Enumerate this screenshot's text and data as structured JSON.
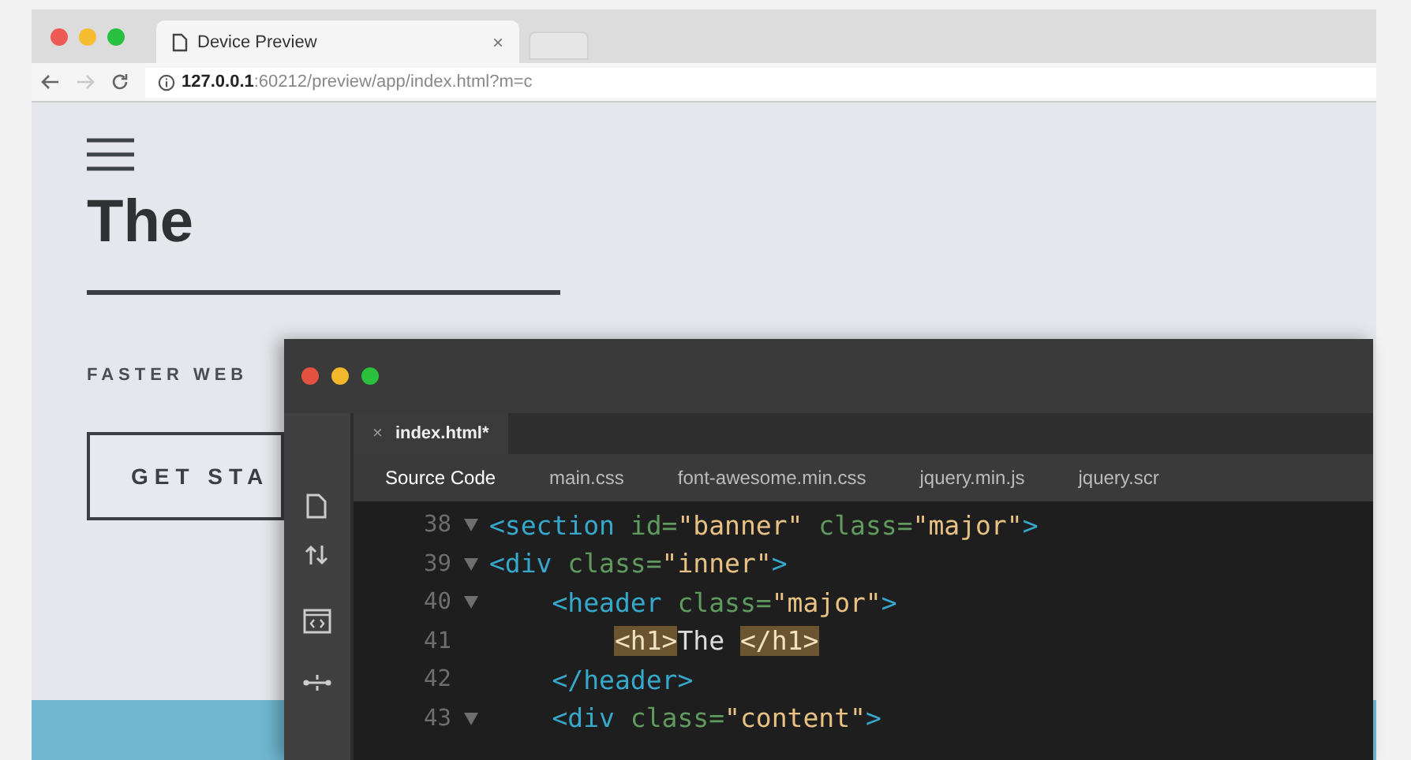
{
  "browser": {
    "tab": {
      "title": "Device Preview",
      "close": "×"
    },
    "address": "**127.0.0.1**:60212/preview/app/index.html?m=c",
    "forward_disabled": true
  },
  "page": {
    "heading": "The",
    "tagline": "FASTER WEB",
    "button": "GET STA"
  },
  "editor": {
    "file_tab": {
      "label": "index.html*",
      "close": "×"
    },
    "tabs": [
      {
        "label": "Source Code",
        "selected": true
      },
      {
        "label": "main.css",
        "selected": false
      },
      {
        "label": "font-awesome.min.css",
        "selected": false
      },
      {
        "label": "jquery.min.js",
        "selected": false
      },
      {
        "label": "jquery.scr",
        "selected": false
      }
    ],
    "lines": [
      {
        "number": "38",
        "fold": true,
        "tokens": [
          {
            "kind": "tag",
            "text": "<section"
          },
          {
            "kind": "attr",
            "text": " id="
          },
          {
            "kind": "str",
            "text": "\"banner\""
          },
          {
            "kind": "attr",
            "text": " class="
          },
          {
            "kind": "str",
            "text": "\"major\""
          },
          {
            "kind": "tag",
            "text": ">"
          }
        ]
      },
      {
        "number": "39",
        "fold": true,
        "tokens": [
          {
            "kind": "tag",
            "text": "<div"
          },
          {
            "kind": "attr",
            "text": " class="
          },
          {
            "kind": "str",
            "text": "\"inner\""
          },
          {
            "kind": "tag",
            "text": ">"
          }
        ],
        "children": [
          {
            "number": "40",
            "fold": true,
            "tokens": [
              {
                "kind": "tag",
                "text": "<header"
              },
              {
                "kind": "attr",
                "text": " class="
              },
              {
                "kind": "str",
                "text": "\"major\""
              },
              {
                "kind": "tag",
                "text": ">"
              }
            ],
            "children": [
              {
                "number": "41",
                "fold": false,
                "tokens": [
                  {
                    "kind": "match",
                    "text": "<h1>"
                  },
                  {
                    "kind": "text",
                    "text": "The "
                  },
                  {
                    "kind": "match",
                    "text": "</h1>"
                  }
                ]
              }
            ]
          },
          {
            "number": "42",
            "fold": false,
            "tokens": [
              {
                "kind": "tag",
                "text": "</header>"
              }
            ]
          },
          {
            "number": "43",
            "fold": true,
            "tokens": [
              {
                "kind": "tag",
                "text": "<div"
              },
              {
                "kind": "attr",
                "text": " class="
              },
              {
                "kind": "str",
                "text": "\"content\""
              },
              {
                "kind": "tag",
                "text": ">"
              }
            ]
          }
        ]
      }
    ]
  }
}
